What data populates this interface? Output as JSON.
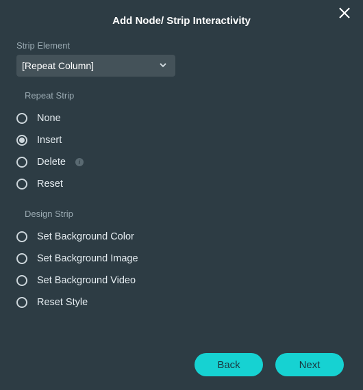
{
  "header": {
    "title": "Add Node/ Strip Interactivity"
  },
  "field": {
    "label": "Strip Element",
    "value": "[Repeat Column]"
  },
  "groups": {
    "repeat": {
      "label": "Repeat Strip",
      "options": {
        "none": {
          "label": "None",
          "info": false
        },
        "insert": {
          "label": "Insert",
          "info": false
        },
        "delete": {
          "label": "Delete",
          "info": true
        },
        "reset": {
          "label": "Reset",
          "info": false
        }
      },
      "selected": "insert"
    },
    "design": {
      "label": "Design Strip",
      "options": {
        "bgcolor": {
          "label": "Set Background Color"
        },
        "bgimage": {
          "label": "Set Background Image"
        },
        "bgvideo": {
          "label": "Set Background Video"
        },
        "resetstyle": {
          "label": "Reset Style"
        }
      },
      "selected": null
    }
  },
  "footer": {
    "back": "Back",
    "next": "Next"
  },
  "info_glyph": "i"
}
